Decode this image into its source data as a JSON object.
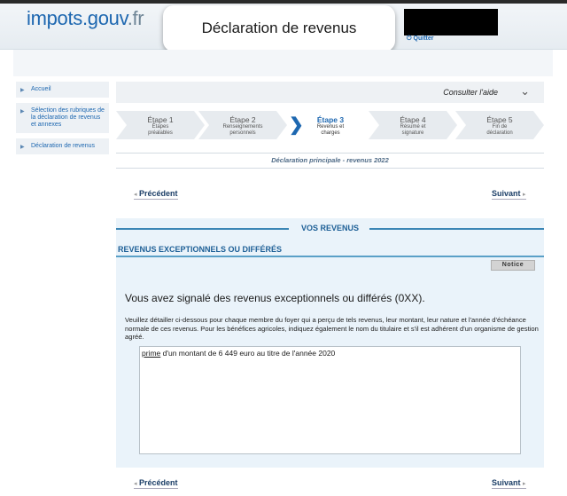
{
  "brand": {
    "part1": "impots",
    "part2": ".gouv",
    "part3": ".fr"
  },
  "overlay_title": "Déclaration de revenus",
  "quit_label": "Quitter",
  "sidebar": {
    "items": [
      {
        "label": "Accueil"
      },
      {
        "label": "Sélection des rubriques de la déclaration de revenus et annexes"
      },
      {
        "label": "Déclaration de revenus"
      }
    ]
  },
  "help": {
    "label": "Consulter l'aide"
  },
  "steps": [
    {
      "label": "Étape 1",
      "sub": "Étapes préalables"
    },
    {
      "label": "Étape 2",
      "sub": "Renseignements personnels"
    },
    {
      "label": "Étape 3",
      "sub": "Revenus et charges",
      "active": true
    },
    {
      "label": "Étape 4",
      "sub": "Résumé et signature"
    },
    {
      "label": "Étape 5",
      "sub": "Fin de déclaration"
    }
  ],
  "declaration_title": "Déclaration principale - revenus 2022",
  "nav": {
    "prev": "Précédent",
    "next": "Suivant"
  },
  "section": {
    "title": "VOS REVENUS",
    "subtitle": "REVENUS EXCEPTIONNELS OU DIFFÉRÉS",
    "notice_button": "Notice",
    "signal_text": "Vous avez signalé des revenus exceptionnels ou différés (0XX).",
    "detail_text": "Veuillez détailler ci-dessous pour chaque membre du foyer qui a perçu de tels revenus, leur montant, leur nature et l'année d'échéance normale de ces revenus. Pour les bénéfices agricoles, indiquez également le nom du titulaire et s'il est adhérent d'un organisme de gestion agréé.",
    "textarea_word": "prime",
    "textarea_rest": " d'un montant de 6 449 euro au titre de l'année 2020"
  },
  "colors": {
    "accent": "#1d67b0",
    "section_bg": "#eaf3fa",
    "rule": "#3b86b5"
  }
}
